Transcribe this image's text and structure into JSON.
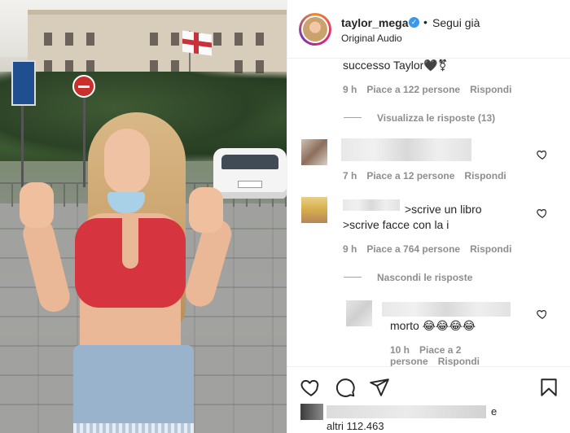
{
  "header": {
    "username": "taylor_mega",
    "separator": "•",
    "follow_label": "Segui già",
    "audio_label": "Original Audio"
  },
  "comments": {
    "partial_text": "successo Taylor🖤⚧",
    "c1_time": "9 h",
    "c1_likes": "Piace a 122 persone",
    "c1_reply": "Rispondi",
    "view_replies": "Visualizza le risposte (13)",
    "c2_time": "7 h",
    "c2_likes": "Piace a 12 persone",
    "c2_reply": "Rispondi",
    "c3_line1": ">scrive un libro",
    "c3_line2": ">scrive facce con la i",
    "c3_time": "9 h",
    "c3_likes": "Piace a 764 persone",
    "c3_reply": "Rispondi",
    "hide_replies": "Nascondi le risposte",
    "r1_text": "morto 😂😂😂😂",
    "r1_time": "10 h",
    "r1_likes": "Piace a 2 persone",
    "r1_reply": "Rispondi"
  },
  "likes": {
    "e": "e",
    "others": "altri 112.463"
  },
  "icons": {
    "verified": "verified-badge-icon",
    "heart": "heart-icon",
    "comment": "comment-icon",
    "share": "paper-plane-icon",
    "save": "bookmark-icon"
  },
  "colors": {
    "verified": "#3897f0",
    "meta_text": "#8e8e8e",
    "primary_text": "#262626",
    "story_ring": [
      "#f58529",
      "#dd2a7b",
      "#8134af"
    ],
    "shirt": "#d6343f"
  }
}
